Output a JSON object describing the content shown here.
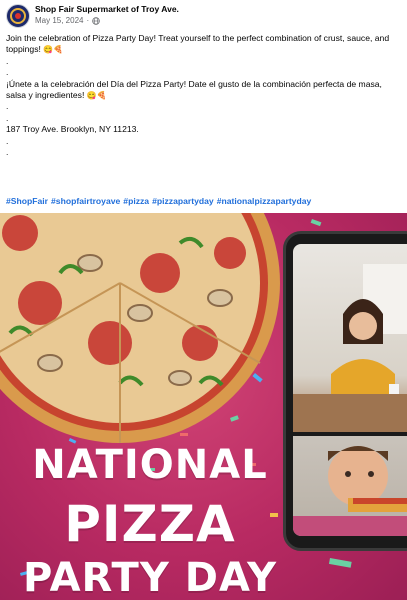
{
  "post": {
    "page_name": "Shop Fair Supermarket of Troy Ave.",
    "date": "May 15, 2024",
    "separator": "·",
    "body": [
      {
        "text": "Join the celebration of Pizza Party Day! Treat yourself to the perfect combination of crust, sauce, and",
        "emoji": ""
      },
      {
        "text": "toppings! ",
        "emoji": "😋🍕"
      },
      {
        "text": ".",
        "emoji": ""
      },
      {
        "text": ".",
        "emoji": ""
      },
      {
        "text": "¡Únete a la celebración del Día del Pizza Party! Date el gusto de la combinación perfecta de masa,",
        "emoji": ""
      },
      {
        "text": "salsa y ingredientes! ",
        "emoji": "😋🍕"
      },
      {
        "text": ".",
        "emoji": ""
      },
      {
        "text": ".",
        "emoji": ""
      },
      {
        "text": "187 Troy Ave. Brooklyn, NY 11213.",
        "emoji": ""
      },
      {
        "text": ".",
        "emoji": ""
      },
      {
        "text": ".",
        "emoji": ""
      }
    ],
    "hashtags": [
      "#ShopFair",
      "#shopfairtroyave",
      "#pizza",
      "#pizzapartyday",
      "#nationalpizzapartyday"
    ]
  },
  "image": {
    "title_line1": "NATIONAL",
    "title_line2": "PIZZA",
    "title_line3": "PARTY DAY"
  },
  "colors": {
    "link": "#216fdb",
    "promo_background": "#b82a62",
    "meta_text": "#65676b"
  },
  "icons": [
    "globe-icon",
    "page-avatar-icon"
  ]
}
